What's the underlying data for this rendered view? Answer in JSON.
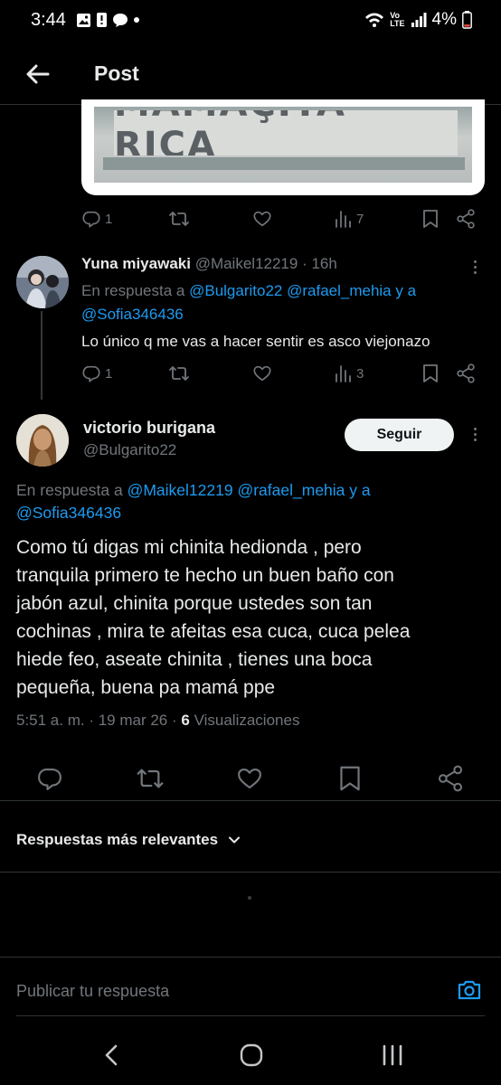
{
  "status_bar": {
    "time": "3:44",
    "volte": "Vo",
    "lte": "LTE",
    "battery": "4%"
  },
  "header": {
    "title": "Post"
  },
  "image_card": {
    "text": "MAMAÇITA RICA"
  },
  "post1_actions": {
    "replies": "1",
    "views": "7"
  },
  "reply1": {
    "name": "Yuna miyawaki",
    "handle": "@Maikel12219",
    "time": "· 16h",
    "replying_prefix": "En respuesta a",
    "mention1": "@Bulgarito22",
    "mention2": "@rafael_mehia",
    "and": "y a",
    "mention3": "@Sofia346436",
    "text": "Lo único q me vas a hacer sentir es asco viejonazo",
    "replies": "1",
    "views": "3"
  },
  "main_post": {
    "name": "victorio burigana",
    "handle": "@Bulgarito22",
    "follow_label": "Seguir",
    "replying_prefix": "En respuesta a",
    "mention1": "@Maikel12219",
    "mention2": "@rafael_mehia",
    "and": "y a",
    "mention3": "@Sofia346436",
    "text_lines": [
      "Como tú digas mi chinita hedionda , pero",
      "tranquila  primero te hecho un buen baño con",
      "jabón azul, chinita porque ustedes son tan",
      "cochinas , mira te afeitas esa cuca, cuca pelea",
      "hiede feo, aseate chinita , tienes una boca",
      "pequeña,  buena pa mamá ppe"
    ],
    "timestamp": "5:51 a. m. · 19 mar 26 ·",
    "views_count": "6",
    "views_label": "Visualizaciones"
  },
  "sort": {
    "label": "Respuestas más relevantes"
  },
  "compose": {
    "placeholder": "Publicar tu respuesta"
  },
  "colors": {
    "background": "#000000",
    "text": "#e7e9ea",
    "muted": "#71767b",
    "link": "#1d9bf0",
    "divider": "#2f3336"
  }
}
